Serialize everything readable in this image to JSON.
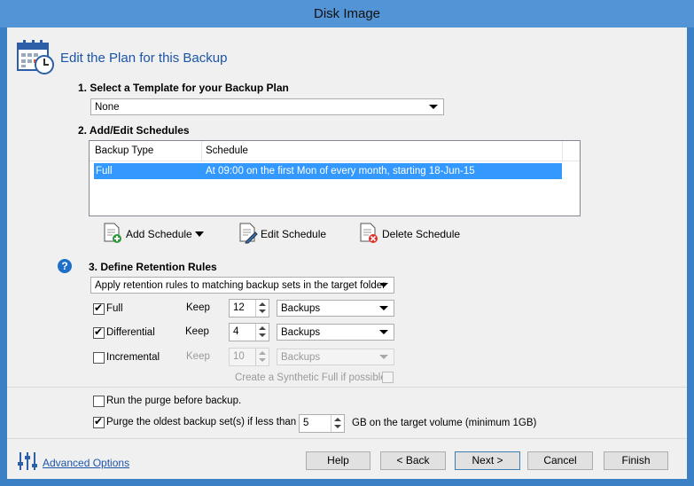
{
  "window": {
    "title": "Disk Image"
  },
  "header": {
    "title": "Edit the Plan for this Backup",
    "icon": "calendar-clock-icon"
  },
  "template_section": {
    "heading": "1. Select a Template for your Backup Plan",
    "selected": "None"
  },
  "schedules_section": {
    "heading": "2. Add/Edit Schedules",
    "columns": [
      "Backup Type",
      "Schedule"
    ],
    "rows": [
      {
        "type": "Full",
        "schedule": "At 09:00 on the first Mon of every month, starting 18-Jun-15",
        "selected": true
      }
    ],
    "buttons": {
      "add": "Add Schedule",
      "edit": "Edit Schedule",
      "delete": "Delete Schedule"
    }
  },
  "retention_section": {
    "heading": "3. Define Retention Rules",
    "rule_mode": "Apply retention rules to matching backup sets in the target folder",
    "rules": [
      {
        "label": "Full",
        "checked": true,
        "keep_label": "Keep",
        "count": "12",
        "unit": "Backups",
        "enabled": true
      },
      {
        "label": "Differential",
        "checked": true,
        "keep_label": "Keep",
        "count": "4",
        "unit": "Backups",
        "enabled": true
      },
      {
        "label": "Incremental",
        "checked": false,
        "keep_label": "Keep",
        "count": "10",
        "unit": "Backups",
        "enabled": false
      }
    ],
    "synthetic_full_label": "Create a Synthetic Full if possible",
    "synthetic_full_checked": false
  },
  "purge": {
    "run_before_label": "Run the purge before backup.",
    "run_before_checked": false,
    "oldest_label": "Purge the oldest backup set(s) if less than",
    "oldest_checked": true,
    "gb_value": "5",
    "gb_suffix": "GB on the target volume (minimum 1GB)"
  },
  "footer": {
    "advanced_label": "Advanced Options",
    "help": "Help",
    "back": "< Back",
    "next": "Next >",
    "cancel": "Cancel",
    "finish": "Finish"
  },
  "colors": {
    "accent": "#1c55a8",
    "titlebar": "#5294d6",
    "selection": "#3399ff"
  }
}
